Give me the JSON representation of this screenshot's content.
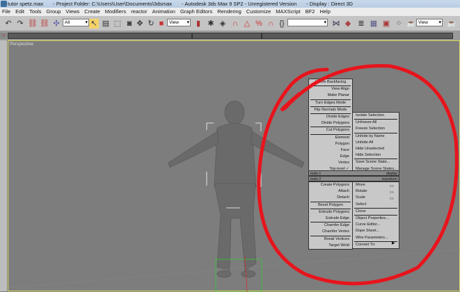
{
  "title": {
    "file": "tutor spetz.max",
    "project": "- Project Folder: C:\\Users\\User\\Documents\\3dsmax",
    "app": "- Autodesk 3ds Max 9 SP2  - Unregistered Version",
    "display": "- Display : Direct 3D"
  },
  "menu": [
    "File",
    "Edit",
    "Tools",
    "Group",
    "Views",
    "Create",
    "Modifiers",
    "reactor",
    "Animation",
    "Graph Editors",
    "Rendering",
    "Customize",
    "MAXScript",
    "BF2",
    "Help"
  ],
  "toolbar": {
    "selection_filter": "All",
    "ref_coord": "View",
    "named_sel": "",
    "render_view": "View"
  },
  "viewport": {
    "label": "Perspective"
  },
  "quad": {
    "top_left": [
      "Ignore Backfacing",
      "View Align",
      "Make Planar",
      "Turn Edges Mode",
      "Flip Normals Mode",
      "Divide Edges",
      "Divide Polygons",
      "Cut Polygons",
      "Element",
      "Polygon",
      "Face",
      "Edge",
      "Vertex",
      "Top-level ✓"
    ],
    "top_right": [
      "Isolate Selection",
      "Unfreeze All",
      "Freeze Selection",
      "Unhide by Name",
      "Unhide All",
      "Hide Unselected",
      "Hide Selection",
      "Save Scene State...",
      "Manage Scene States..."
    ],
    "headers": {
      "tools1": "tools 1",
      "display": "display",
      "tools2": "tools 2",
      "transform": "transform"
    },
    "bottom_left": [
      "Create Polygons",
      "Attach",
      "Detach",
      "Bevel Polygon",
      "Extrude Polygons",
      "Extrude Edge",
      "Chamfer Edge",
      "Chamfer Vertex",
      "Break Vertices",
      "Target Weld"
    ],
    "bottom_right": [
      "Move",
      "Rotate",
      "Scale",
      "Select",
      "Clone",
      "Object Properties...",
      "Curve Editor...",
      "Dope Sheet...",
      "Wire Parameters...",
      "Convert To:"
    ]
  },
  "colors": {
    "annotation": "#e8141c",
    "viewport_bg": "#7d7d7d",
    "active_border": "#d8d860"
  }
}
